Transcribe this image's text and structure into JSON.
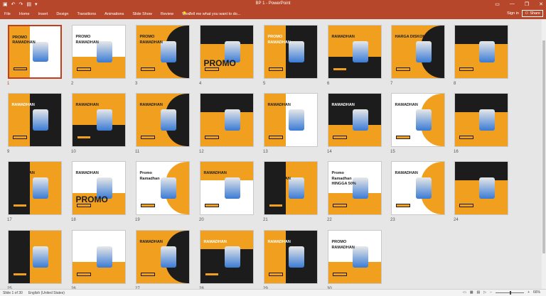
{
  "window": {
    "title": "BP 1 - PowerPoint",
    "controls": [
      "—",
      "❐",
      "✕"
    ]
  },
  "ribbon": {
    "tabs": [
      "File",
      "Home",
      "Insert",
      "Design",
      "Transitions",
      "Animations",
      "Slide Show",
      "Review",
      "View"
    ],
    "tell_me": "Tell me what you want to do...",
    "sign_in": "Sign in",
    "share": "Share"
  },
  "colors": {
    "accent": "#b7472a",
    "selected": "#c43e1c",
    "orange": "#f0a01e",
    "dark": "#1c1c1c"
  },
  "slides": [
    {
      "num": "1",
      "theme": "white",
      "selected": true,
      "texts": [
        "PROMO",
        "RAMADHAN"
      ]
    },
    {
      "num": "2",
      "theme": "white",
      "texts": [
        "PROMO",
        "RAMADHAN"
      ]
    },
    {
      "num": "3",
      "theme": "orange",
      "texts": [
        "PROMO",
        "RAMADHAN"
      ]
    },
    {
      "num": "4",
      "theme": "orange",
      "texts": [
        "RAMADHAN",
        "PROMO"
      ]
    },
    {
      "num": "5",
      "theme": "dark",
      "texts": [
        "PROMO",
        "RAMADHAN"
      ]
    },
    {
      "num": "6",
      "theme": "orange",
      "texts": [
        "RAMADHAN"
      ]
    },
    {
      "num": "7",
      "theme": "orange",
      "texts": [
        "HARGA DISKON"
      ]
    },
    {
      "num": "8",
      "theme": "orange",
      "texts": [
        "HARGA DISKON"
      ]
    },
    {
      "num": "9",
      "theme": "dark",
      "texts": [
        "RAMADHAN"
      ]
    },
    {
      "num": "10",
      "theme": "orange",
      "texts": [
        "RAMADHAN"
      ]
    },
    {
      "num": "11",
      "theme": "orange",
      "texts": [
        "RAMADHAN"
      ]
    },
    {
      "num": "12",
      "theme": "orange",
      "texts": [
        "RAMADHAN"
      ]
    },
    {
      "num": "13",
      "theme": "white",
      "texts": [
        "RAMADHAN"
      ]
    },
    {
      "num": "14",
      "theme": "dark",
      "texts": [
        "RAMADHAN"
      ]
    },
    {
      "num": "15",
      "theme": "white",
      "texts": [
        "RAMADHAN"
      ]
    },
    {
      "num": "16",
      "theme": "orange",
      "texts": [
        "DISKON"
      ]
    },
    {
      "num": "17",
      "theme": "orange",
      "texts": [
        "RAMADHAN",
        "DISKON"
      ]
    },
    {
      "num": "18",
      "theme": "white",
      "texts": [
        "RAMADHAN",
        "PROMO"
      ]
    },
    {
      "num": "19",
      "theme": "white",
      "texts": [
        "Promo",
        "Ramadhan"
      ]
    },
    {
      "num": "20",
      "theme": "white",
      "texts": [
        "RAMADHAN"
      ]
    },
    {
      "num": "21",
      "theme": "orange",
      "texts": [
        "PROMO",
        "RAMADHAN"
      ]
    },
    {
      "num": "22",
      "theme": "white",
      "texts": [
        "Promo",
        "Ramadhan",
        "HINGGA 50%"
      ]
    },
    {
      "num": "23",
      "theme": "white",
      "texts": [
        "RAMADHAN"
      ]
    },
    {
      "num": "24",
      "theme": "orange",
      "texts": [
        "PROMO"
      ]
    },
    {
      "num": "25",
      "theme": "orange",
      "texts": [
        "PROMO"
      ]
    },
    {
      "num": "26",
      "theme": "white",
      "texts": []
    },
    {
      "num": "27",
      "theme": "orange",
      "texts": [
        "RAMADHAN"
      ]
    },
    {
      "num": "28",
      "theme": "dark",
      "texts": [
        "RAMADHAN"
      ]
    },
    {
      "num": "29",
      "theme": "dark",
      "texts": [
        "RAMADHAN"
      ]
    },
    {
      "num": "30",
      "theme": "white",
      "texts": [
        "PROMO",
        "RAMADHAN"
      ]
    }
  ],
  "status": {
    "slide_of": "Slide 1 of 30",
    "language": "English (United States)",
    "zoom": "66%"
  }
}
